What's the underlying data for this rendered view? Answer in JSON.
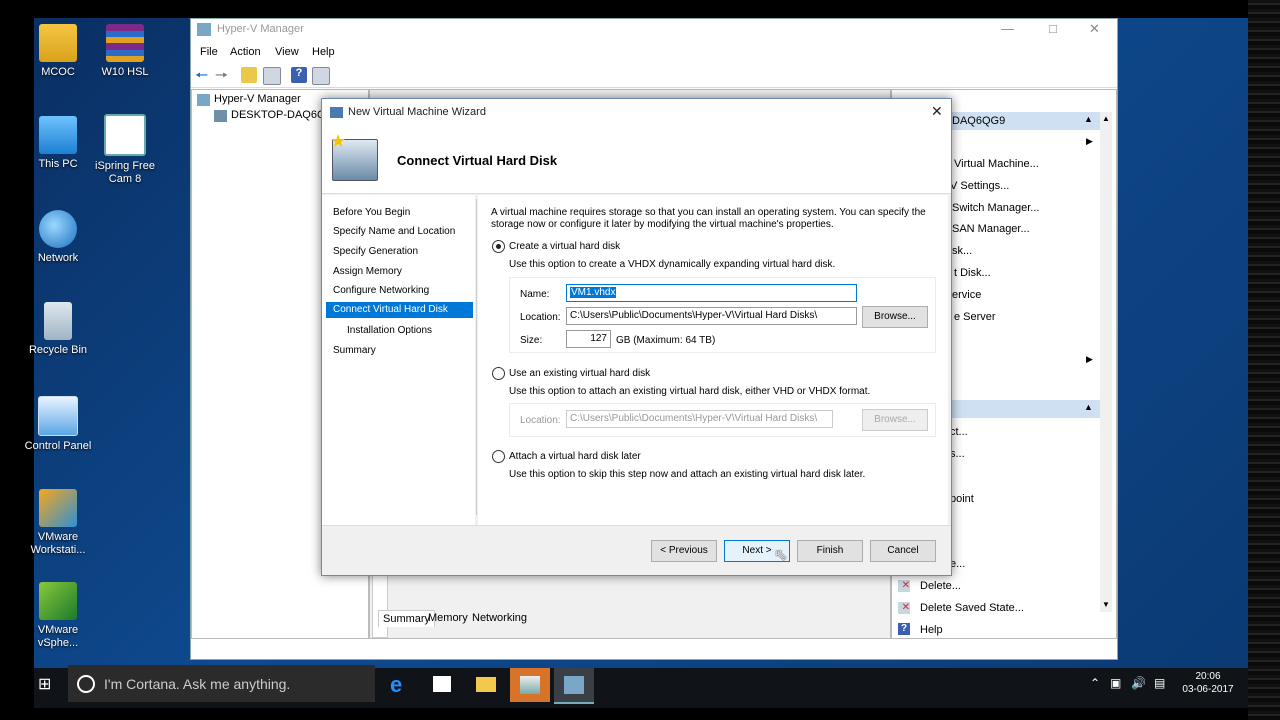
{
  "desktop_icons": [
    {
      "label": "MCOC"
    },
    {
      "label": "W10 HSL"
    },
    {
      "label": "This PC"
    },
    {
      "label": "iSpring Free Cam 8"
    },
    {
      "label": "Network"
    },
    {
      "label": "Recycle Bin"
    },
    {
      "label": "Control Panel"
    },
    {
      "label": "VMware Workstati..."
    },
    {
      "label": "VMware vSphe..."
    }
  ],
  "hyperv": {
    "title": "Hyper-V Manager",
    "menu": [
      "File",
      "Action",
      "View",
      "Help"
    ],
    "tree_root": "Hyper-V Manager",
    "tree_host": "DESKTOP-DAQ6QG9",
    "actions_header": "DAQ6QG9",
    "actions": [
      "Virtual Machine...",
      "V Settings...",
      "Switch Manager...",
      "SAN Manager...",
      "sk...",
      "t Disk...",
      "ervice",
      "e Server",
      "Delete...",
      "Delete Saved State...",
      "Help"
    ],
    "actions_fragments": [
      "ct...",
      "s...",
      "point",
      "e..."
    ],
    "bottom_tabs": [
      "Summary",
      "Memory",
      "Networking"
    ]
  },
  "wizard": {
    "window_title": "New Virtual Machine Wizard",
    "heading": "Connect Virtual Hard Disk",
    "steps": [
      "Before You Begin",
      "Specify Name and Location",
      "Specify Generation",
      "Assign Memory",
      "Configure Networking",
      "Connect Virtual Hard Disk",
      "Installation Options",
      "Summary"
    ],
    "intro_line1": "A virtual machine requires storage so that you can install an operating system. You can specify the",
    "intro_line2": "storage now or configure it later by modifying the virtual machine's properties.",
    "opt_create": "Create a virtual hard disk",
    "opt_create_desc": "Use this option to create a VHDX dynamically expanding virtual hard disk.",
    "name_label": "Name:",
    "name_value": "VM1.vhdx",
    "location_label": "Location:",
    "location_value": "C:\\Users\\Public\\Documents\\Hyper-V\\Virtual Hard Disks\\",
    "browse_label": "Browse...",
    "size_label": "Size:",
    "size_value": "127",
    "size_unit": "GB (Maximum: 64 TB)",
    "opt_existing": "Use an existing virtual hard disk",
    "opt_existing_desc": "Use this option to attach an existing virtual hard disk, either VHD or VHDX format.",
    "existing_location_value": "C:\\Users\\Public\\Documents\\Hyper-V\\Virtual Hard Disks\\",
    "opt_later": "Attach a virtual hard disk later",
    "opt_later_desc": "Use this option to skip this step now and attach an existing virtual hard disk later.",
    "btn_previous": "< Previous",
    "btn_next": "Next >",
    "btn_finish": "Finish",
    "btn_cancel": "Cancel"
  },
  "taskbar": {
    "cortana_placeholder": "I'm Cortana. Ask me anything.",
    "time": "20:06",
    "date": "03-06-2017"
  },
  "colors": {
    "accent": "#0078d7",
    "desktop": "#0e4a8f",
    "taskbar": "#101418"
  }
}
